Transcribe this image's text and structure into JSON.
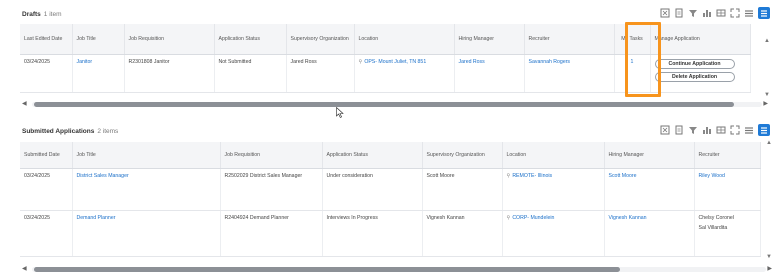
{
  "drafts": {
    "title": "Drafts",
    "count": "1 item",
    "columns": [
      "Last Edited Date",
      "Job Title",
      "Job Requisition",
      "Application Status",
      "Supervisory Organization",
      "Location",
      "Hiring Manager",
      "Recruiter",
      "My Tasks",
      "Manage Application"
    ],
    "rows": [
      {
        "last_edited": "03/24/2025",
        "job_title": "Janitor",
        "requisition": "R2301808 Janitor",
        "status": "Not Submitted",
        "org": "Jared Ross",
        "location": "OPS- Mount Juliet, TN 851",
        "hiring_manager": "Jared Ross",
        "recruiter": "Savannah Rogers",
        "my_tasks": "1",
        "continue_label": "Continue Application",
        "delete_label": "Delete Application"
      }
    ]
  },
  "submitted": {
    "title": "Submitted Applications",
    "count": "2 items",
    "columns": [
      "Submitted Date",
      "Job Title",
      "Job Requisition",
      "Application Status",
      "Supervisory Organization",
      "Location",
      "Hiring Manager",
      "Recruiter"
    ],
    "rows": [
      {
        "date": "03/24/2025",
        "job_title": "District Sales Manager",
        "requisition": "R2502029 District Sales Manager",
        "status": "Under consideration",
        "org": "Scott Moore",
        "location": "REMOTE- Illinois",
        "hiring_manager": "Scott Moore",
        "recruiter": "Riley Wood"
      },
      {
        "date": "03/24/2025",
        "job_title": "Demand Planner",
        "requisition": "R2404924 Demand Planner",
        "status": "Interviews In Progress",
        "org": "Vignesh Kannan",
        "location": "CORP- Mundelein",
        "hiring_manager": "Vignesh Kannan",
        "recruiter_1": "Chelsy Coronel",
        "recruiter_2": "Sal Villardita"
      }
    ]
  },
  "scrollbars": {
    "drafts_position": 0.0,
    "submitted_position": 0.0
  },
  "icons": [
    "export-excel-icon",
    "export-pdf-icon",
    "filter-icon",
    "chart-icon",
    "table-view-icon",
    "fullscreen-icon",
    "list-view-icon",
    "grid-view-icon"
  ],
  "colors": {
    "link": "#1a6fc9",
    "highlight": "#f7941d",
    "active_view": "#1f7ad6",
    "header_bg": "#f4f5f7"
  }
}
